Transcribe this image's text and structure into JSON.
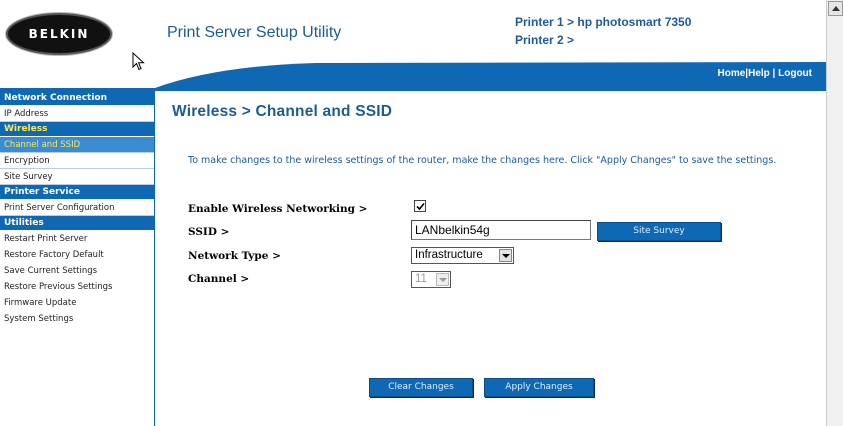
{
  "header": {
    "logo_text": "BELKIN",
    "app_title": "Print Server Setup Utility",
    "printer1": "Printer 1 > hp photosmart 7350",
    "printer2": "Printer 2 >",
    "nav": {
      "home": "Home",
      "sep": "|",
      "help": "Help",
      "logout": "Logout"
    }
  },
  "sidebar": {
    "sections": [
      {
        "heading": "Network Connection",
        "items": [
          "IP Address"
        ]
      },
      {
        "heading": "Wireless",
        "items": [
          "Channel and SSID",
          "Encryption",
          "Site Survey"
        ]
      },
      {
        "heading": "Printer Service",
        "items": [
          "Print Server Configuration"
        ]
      },
      {
        "heading": "Utilities",
        "items": [
          "Restart Print Server",
          "Restore Factory Default",
          "Save Current Settings",
          "Restore Previous Settings",
          "Firmware Update",
          "System Settings"
        ]
      }
    ]
  },
  "main": {
    "title": "Wireless > Channel and SSID",
    "intro": "To make changes to the wireless settings of the router, make the changes here. Click \"Apply Changes\" to save the settings.",
    "form": {
      "enable_label": "Enable Wireless Networking >",
      "enable_checked": true,
      "ssid_label": "SSID >",
      "ssid_value": "LANbelkin54g",
      "network_type_label": "Network Type >",
      "network_type_value": "Infrastructure",
      "channel_label": "Channel >",
      "channel_value": "11"
    },
    "site_survey_button": "Site Survey",
    "clear_button": "Clear Changes",
    "apply_button": "Apply Changes"
  },
  "colors": {
    "brand_blue": "#0f68b4",
    "title_blue": "#1d5b97",
    "highlight_yellow": "#ffe94a"
  }
}
